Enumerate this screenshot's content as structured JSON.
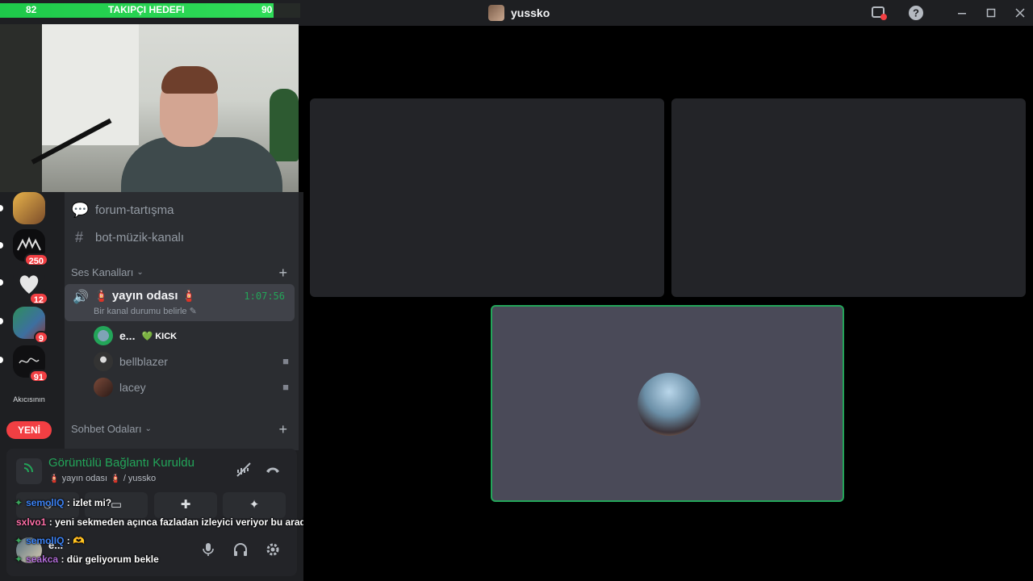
{
  "window": {
    "title": "yussko"
  },
  "goal": {
    "current": "82",
    "label": "TAKIPÇI HEDEFI",
    "target": "90",
    "progress": 0.911
  },
  "sidebar": {
    "guild_badges": [
      "250",
      "12",
      "9",
      "91"
    ],
    "guild_text": "Akıcısının",
    "new_label": "YENİ"
  },
  "channels": {
    "text": [
      {
        "name": "forum-tartışma"
      },
      {
        "name": "bot-müzik-kanalı"
      }
    ],
    "voice_category": "Ses Kanalları",
    "voice_channel": {
      "name": "🧯 yayın odası 🧯",
      "time": "1:07:56",
      "status": "Bir kanal durumu belirle"
    },
    "members": [
      {
        "name": "e...",
        "tag": "💚 KICK"
      },
      {
        "name": "bellblazer"
      },
      {
        "name": "lacey"
      }
    ],
    "chat_category": "Sohbet Odaları"
  },
  "voice_panel": {
    "title": "Görüntülü Bağlantı Kuruldu",
    "subtitle": "🧯 yayın odası 🧯 / yussko"
  },
  "user": {
    "name": "e..."
  },
  "chat": [
    {
      "user": "semolIQ",
      "text": ": izlet mi?"
    },
    {
      "user": "sxlvo1",
      "text": ": yeni sekmeden açınca fazladan izleyici veriyor bu arada"
    },
    {
      "user": "semolIQ",
      "text": ": 🫶"
    },
    {
      "user": "seakca",
      "text": ": dür geliyorum bekle"
    }
  ],
  "colors": {
    "accent_green": "#23a559",
    "goal_green": "#2fdc58",
    "badge_red": "#f23f43",
    "chat_user_blue": "#3b82f6",
    "chat_user_pink": "#ff6fa8"
  }
}
